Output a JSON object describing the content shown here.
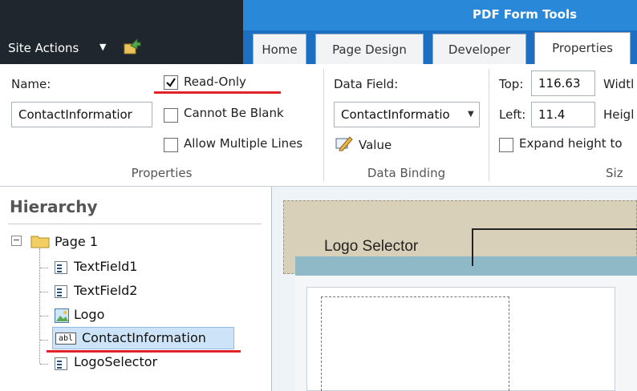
{
  "titlebar": {
    "site_actions": "Site Actions",
    "context_group": "PDF Form Tools"
  },
  "tabs": [
    {
      "label": "Home"
    },
    {
      "label": "Page Design"
    },
    {
      "label": "Developer"
    },
    {
      "label": "Properties",
      "active": true
    }
  ],
  "ribbon": {
    "properties_group": {
      "name_label": "Name:",
      "name_value": "ContactInformatior",
      "read_only": {
        "label": "Read-Only",
        "checked": true
      },
      "cannot_be_blank": {
        "label": "Cannot Be Blank",
        "checked": false
      },
      "allow_multiple_lines": {
        "label": "Allow Multiple Lines",
        "checked": false
      },
      "group_label": "Properties"
    },
    "data_binding_group": {
      "data_field_label": "Data Field:",
      "data_field_value": "ContactInformatio",
      "value_button": "Value",
      "group_label": "Data Binding"
    },
    "size_group": {
      "top_label": "Top:",
      "top_value": "116.63",
      "width_label": "Widtl",
      "left_label": "Left:",
      "left_value": "11.4",
      "height_label": "Heigl",
      "expand_label": "Expand height to",
      "expand_checked": false,
      "group_label": "Siz"
    }
  },
  "hierarchy": {
    "title": "Hierarchy",
    "root": {
      "label": "Page 1",
      "icon": "folder-icon"
    },
    "items": [
      {
        "label": "TextField1",
        "icon": "textfield-icon"
      },
      {
        "label": "TextField2",
        "icon": "textfield-icon"
      },
      {
        "label": "Logo",
        "icon": "image-icon"
      },
      {
        "label": "ContactInformation",
        "icon": "abl-icon",
        "selected": true
      },
      {
        "label": "LogoSelector",
        "icon": "textfield-icon"
      }
    ]
  },
  "canvas": {
    "logo_selector_caption": "Logo Selector"
  },
  "colors": {
    "accent": "#2a88d8",
    "dark_bar": "#20262d",
    "highlight": "#e0232a",
    "selection": "#cde3f7"
  }
}
